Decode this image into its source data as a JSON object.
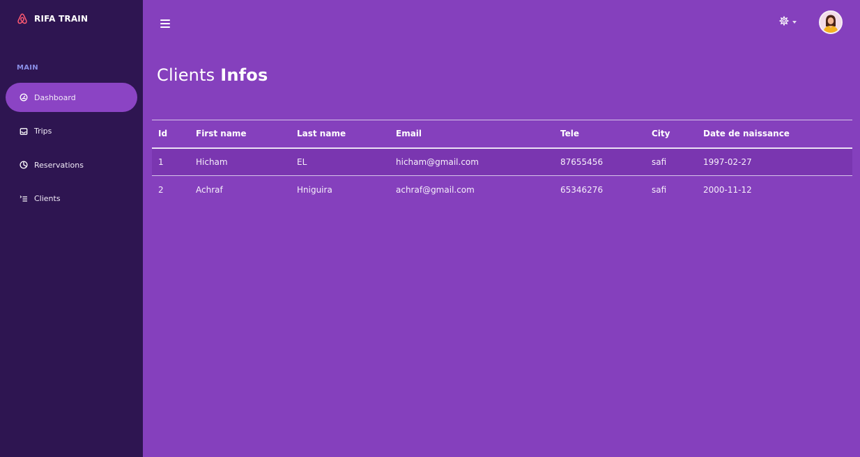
{
  "brand": {
    "name": "RIFA TRAIN",
    "icon": "airbnb-logo-icon",
    "icon_color": "#ff5a72"
  },
  "sidebar": {
    "section_label": "MAIN",
    "items": [
      {
        "label": "Dashboard",
        "icon": "gauge-icon",
        "active": true
      },
      {
        "label": "Trips",
        "icon": "inbox-icon",
        "active": false
      },
      {
        "label": "Reservations",
        "icon": "pie-chart-icon",
        "active": false
      },
      {
        "label": "Clients",
        "icon": "list-icon",
        "active": false
      }
    ]
  },
  "header": {
    "menu_icon": "hamburger-icon",
    "settings_icon": "gear-icon",
    "avatar": "user-avatar"
  },
  "page": {
    "title_light": "Clients",
    "title_bold": "Infos"
  },
  "table": {
    "columns": [
      "Id",
      "First name",
      "Last name",
      "Email",
      "Tele",
      "City",
      "Date de naissance"
    ],
    "rows": [
      [
        "1",
        "Hicham",
        "EL",
        "hicham@gmail.com",
        "87655456",
        "safi",
        "1997-02-27"
      ],
      [
        "2",
        "Achraf",
        "Hniguira",
        "achraf@gmail.com",
        "65346276",
        "safi",
        "2000-11-12"
      ]
    ]
  },
  "colors": {
    "sidebar_bg": "#2e1551",
    "main_bg": "#8540bd",
    "active_item": "#8b44c4",
    "section_label": "#8a8fe6"
  }
}
